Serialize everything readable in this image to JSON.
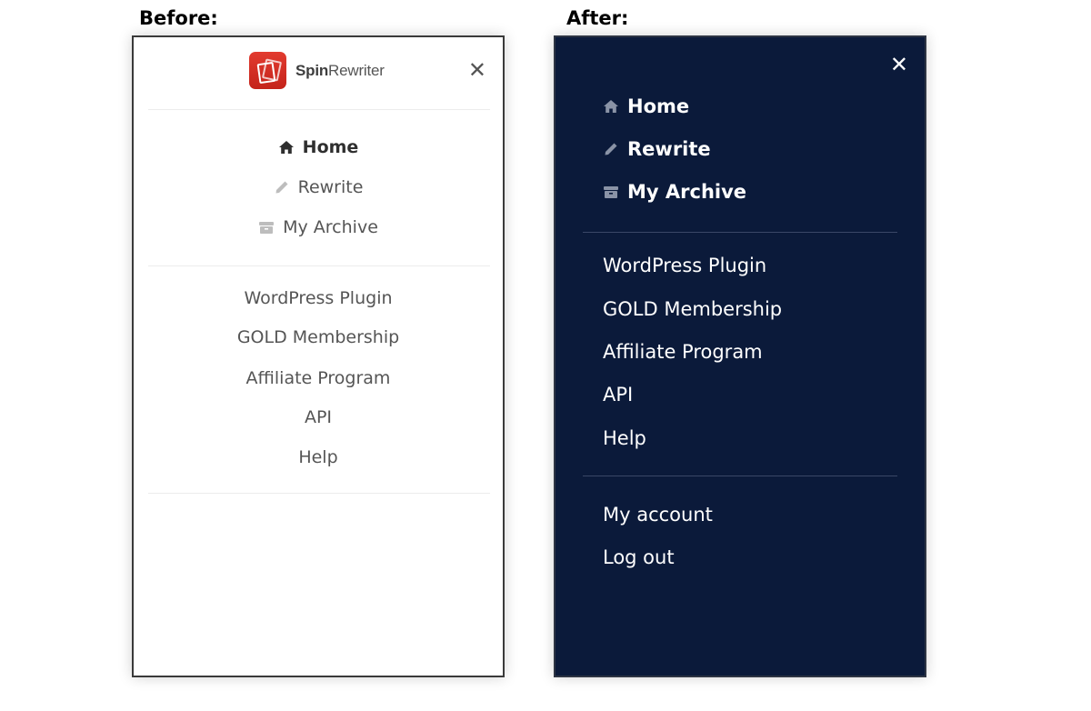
{
  "captions": {
    "before": "Before:",
    "after": "After:"
  },
  "before": {
    "logo": {
      "brand_bold": "Spin",
      "brand_rest": "Rewriter",
      "mark_color": "#d42e22"
    },
    "close_label": "✕",
    "primary_nav": [
      {
        "label": "Home",
        "icon": "home-icon",
        "active": true
      },
      {
        "label": "Rewrite",
        "icon": "pencil-icon",
        "active": false
      },
      {
        "label": "My Archive",
        "icon": "archive-icon",
        "active": false
      }
    ],
    "secondary_nav": [
      {
        "label": "WordPress Plugin"
      },
      {
        "label": "GOLD Membership"
      },
      {
        "label": "Affiliate Program"
      },
      {
        "label": "API"
      },
      {
        "label": "Help"
      }
    ]
  },
  "after": {
    "background_color": "#0b1a3a",
    "close_label": "✕",
    "primary_nav": [
      {
        "label": "Home",
        "icon": "home-icon"
      },
      {
        "label": "Rewrite",
        "icon": "pencil-icon"
      },
      {
        "label": "My Archive",
        "icon": "archive-icon"
      }
    ],
    "secondary_nav": [
      {
        "label": "WordPress Plugin"
      },
      {
        "label": "GOLD Membership"
      },
      {
        "label": "Affiliate Program"
      },
      {
        "label": "API"
      },
      {
        "label": "Help"
      }
    ],
    "account_nav": [
      {
        "label": "My account"
      },
      {
        "label": "Log out"
      }
    ]
  }
}
